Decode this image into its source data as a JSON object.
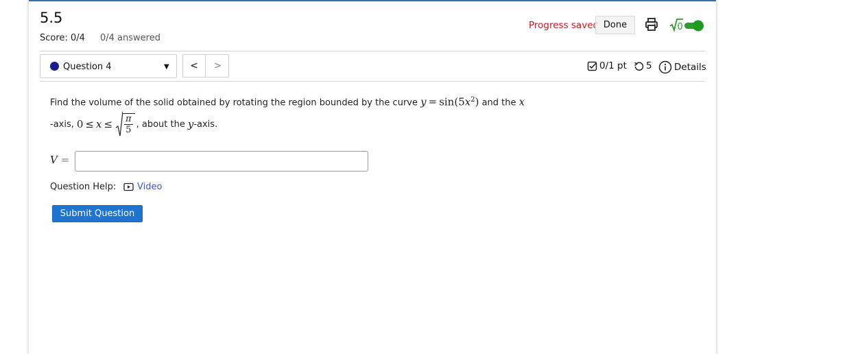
{
  "header": {
    "title": "5.5",
    "score": "Score: 0/4",
    "answered": "0/4 answered",
    "progress_saved": "Progress saved",
    "done_label": "Done",
    "math_toggle_label": "√0"
  },
  "question_nav": {
    "selected": "Question 4",
    "prev": "<",
    "next": ">"
  },
  "meta": {
    "points": "0/1 pt",
    "retries": "5",
    "details": "Details"
  },
  "question": {
    "text_1": "Find the volume of the solid obtained by rotating the region bounded by the curve",
    "curve_lhs": "y",
    "equals": "=",
    "curve_rhs_fn": "sin",
    "curve_rhs_arg_prefix": "(5",
    "curve_rhs_var": "x",
    "curve_rhs_exp": "2",
    "curve_rhs_close": ")",
    "text_2": "and the",
    "x_var": "x",
    "text_3": "-axis,",
    "bound_lo": "0",
    "leq": "≤",
    "bound_var": "x",
    "frac_num": "π",
    "frac_den": "5",
    "text_4": ", about the",
    "y_var": "y",
    "text_5": "-axis.",
    "answer_var": "V",
    "answer_eq": "=",
    "answer_value": ""
  },
  "help": {
    "label": "Question Help:",
    "video_label": "Video"
  },
  "submit_label": "Submit Question",
  "colors": {
    "progress_saved": "#c0191e",
    "submit": "#1f74d0",
    "toggle": "#2e9b2e",
    "question_dot": "#1a1a8c",
    "link": "#3b5db5"
  },
  "icons": [
    "print-icon",
    "math-toggle-icon",
    "checkbox-icon",
    "retry-icon",
    "info-icon",
    "video-icon",
    "caret-down-icon"
  ]
}
